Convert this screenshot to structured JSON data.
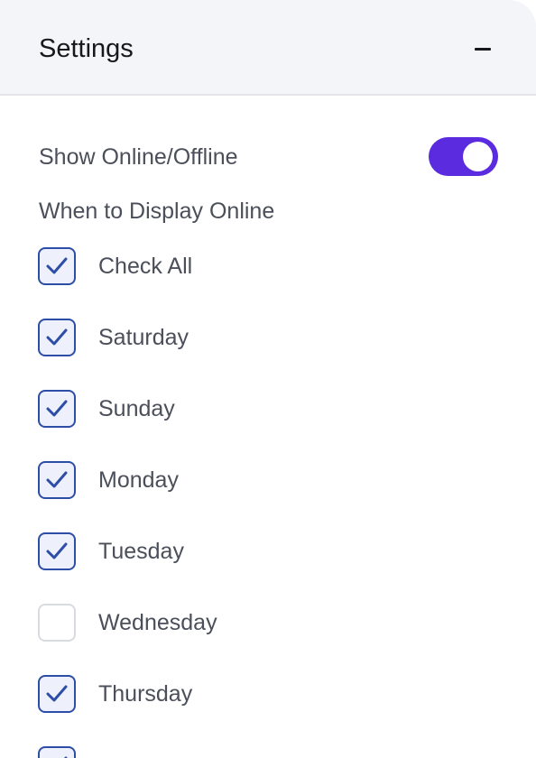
{
  "header": {
    "title": "Settings",
    "collapse_icon": "minus-icon"
  },
  "online_toggle": {
    "label": "Show Online/Offline",
    "enabled": true,
    "track_color": "#5b2be0"
  },
  "display_section": {
    "label": "When to Display Online"
  },
  "checkboxes": [
    {
      "label": "Check All",
      "checked": true
    },
    {
      "label": "Saturday",
      "checked": true
    },
    {
      "label": "Sunday",
      "checked": true
    },
    {
      "label": "Monday",
      "checked": true
    },
    {
      "label": "Tuesday",
      "checked": true
    },
    {
      "label": "Wednesday",
      "checked": false
    },
    {
      "label": "Thursday",
      "checked": true
    },
    {
      "label": "",
      "checked": true
    }
  ],
  "colors": {
    "checkbox_checked_border": "#2d4ea6",
    "checkbox_unchecked_border": "#d8dbe0",
    "header_bg": "#f4f5f8"
  }
}
